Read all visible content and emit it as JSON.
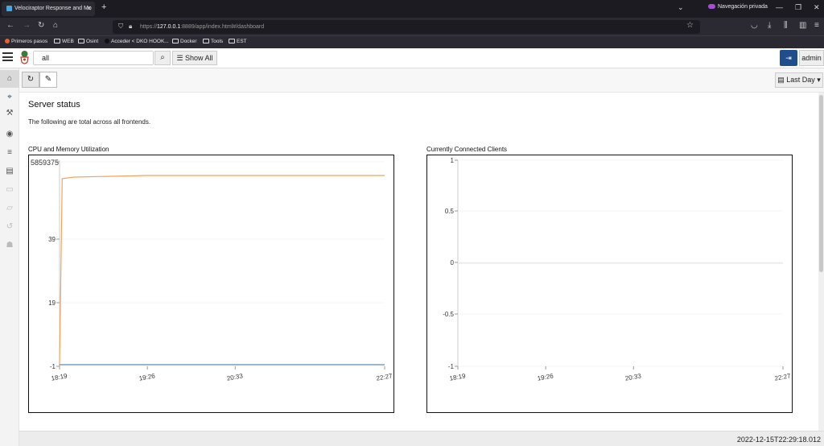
{
  "browser": {
    "tab_title": "Velociraptor Response and Mo",
    "tab_close": "✕",
    "new_tab": "+",
    "private_label": "Navegación privada",
    "url_prefix": "https://",
    "url_host": "127.0.0.1",
    "url_rest": ":8889/app/index.html#/dashboard",
    "bookmarks": [
      "Primeros pasos",
      "WEB",
      "Osint",
      "Acceder < DKO HOOK...",
      "Docker",
      "Tools",
      "EST"
    ]
  },
  "app": {
    "search_value": "all",
    "show_all_label": "Show All",
    "user_label": "admin",
    "time_range_label": "Last Day",
    "page_title": "Server status",
    "subtitle": "The following are total across all frontends.",
    "footer_time": "2022-12-15T22:29:18.012"
  },
  "colors": {
    "accent": "#1f4e8c",
    "cpu_series": "#f5a25d",
    "mem_series": "#5b8db8"
  },
  "chart_data": [
    {
      "type": "line",
      "title": "CPU and Memory Utilization",
      "y_tick_labels": [
        "5859375",
        "39",
        "19",
        "-1"
      ],
      "x_tick_labels": [
        "18:19",
        "19:26",
        "20:33",
        "22:27"
      ],
      "x": [
        "18:19",
        "18:21",
        "18:30",
        "19:26",
        "20:33",
        "22:27"
      ],
      "series": [
        {
          "values": [
            -1,
            58,
            58.5,
            59,
            59,
            59
          ]
        },
        {
          "values": [
            -0.5,
            -0.5,
            -0.5,
            -0.5,
            -0.5,
            -0.5
          ]
        }
      ]
    },
    {
      "type": "line",
      "title": "Currently Connected Clients",
      "y_tick_labels": [
        "1",
        "0.5",
        "0",
        "-0.5",
        "-1"
      ],
      "x_tick_labels": [
        "18:19",
        "19:26",
        "20:33",
        "22:27"
      ],
      "x": [
        "18:19",
        "22:27"
      ],
      "series": [
        {
          "values": [
            0,
            0
          ]
        }
      ],
      "ylim": [
        -1,
        1
      ]
    }
  ]
}
